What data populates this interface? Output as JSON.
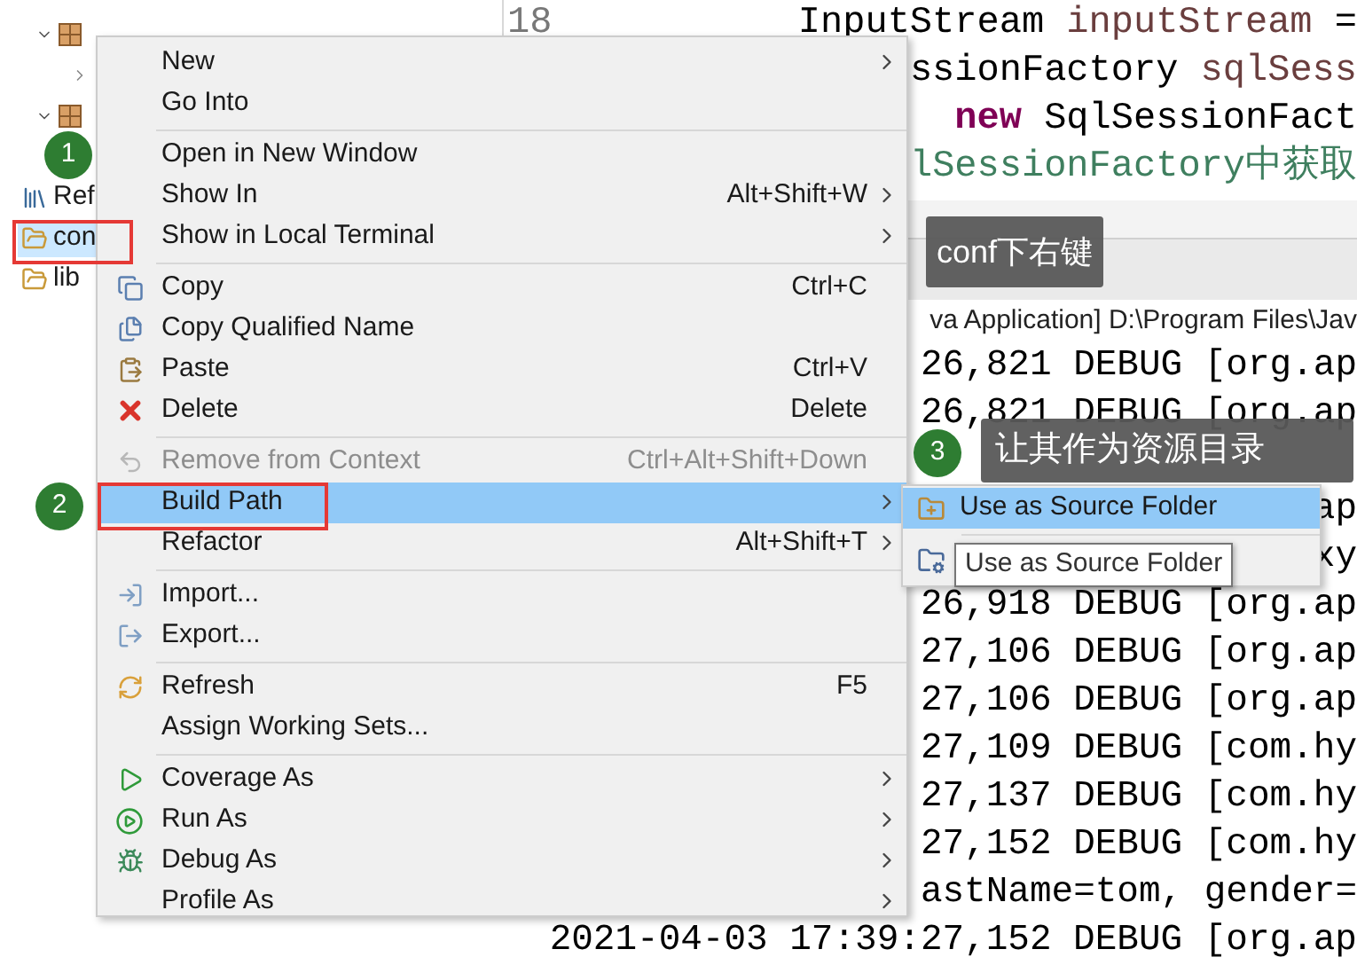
{
  "tree": [
    {
      "children": [
        {
          "kind": "package",
          "expanded": true,
          "children": [
            {
              "expanded": false
            }
          ]
        },
        {
          "kind": "package",
          "expanded": true
        }
      ]
    },
    {
      "label": "Ref",
      "kind": "library",
      "selected": false
    },
    {
      "label": "con",
      "kind": "folder",
      "selected": true
    },
    {
      "label": "lib",
      "kind": "folder",
      "selected": false
    }
  ],
  "editor": {
    "line_number": "18",
    "lines": [
      [
        {
          "kind": "plain",
          "text": "InputStream "
        },
        {
          "kind": "variable",
          "text": "inputStream"
        },
        {
          "kind": "plain",
          "text": " ="
        }
      ],
      [
        {
          "kind": "plain",
          "text": "ssionFactory "
        },
        {
          "kind": "variable",
          "text": "sqlSess"
        }
      ],
      [
        {
          "kind": "keyword",
          "text": "new"
        },
        {
          "kind": "plain",
          "text": " SqlSessionFact"
        }
      ],
      [
        {
          "kind": "comment",
          "text": "lSessionFactory中获取"
        }
      ]
    ]
  },
  "console": {
    "header": "va Application] D:\\Program Files\\Jav",
    "lines": [
      {
        "text": "26,821 DEBUG [org.ap"
      },
      {
        "text": "26,821 DEBUG [org.ap"
      },
      {
        "text": "ap"
      },
      {
        "text": "xy"
      },
      {
        "text": "26,918 DEBUG [org.ap"
      },
      {
        "text": "27,106 DEBUG [org.ap"
      },
      {
        "text": "27,106 DEBUG [org.ap"
      },
      {
        "text": "27,109 DEBUG [com.hy"
      },
      {
        "text": "27,137 DEBUG [com.hy"
      },
      {
        "text": "27,152 DEBUG [com.hy"
      },
      {
        "text": "astName=tom, gender="
      },
      {
        "text": "2021-04-03 17:39:27,152 DEBUG [org.ap"
      }
    ]
  },
  "context_menu": [
    {
      "kind": "item",
      "label": "New",
      "submenu": true,
      "disabled": false,
      "selected": false
    },
    {
      "kind": "item",
      "label": "Go Into",
      "submenu": false,
      "disabled": false,
      "selected": false
    },
    {
      "kind": "separator"
    },
    {
      "kind": "item",
      "label": "Open in New Window",
      "submenu": false,
      "disabled": false,
      "selected": false
    },
    {
      "kind": "item",
      "label": "Show In",
      "shortcut": "Alt+Shift+W",
      "submenu": true,
      "disabled": false,
      "selected": false
    },
    {
      "kind": "item",
      "label": "Show in Local Terminal",
      "submenu": true,
      "disabled": false,
      "selected": false
    },
    {
      "kind": "separator"
    },
    {
      "kind": "item",
      "label": "Copy",
      "shortcut": "Ctrl+C",
      "submenu": false,
      "disabled": false,
      "selected": false
    },
    {
      "kind": "item",
      "label": "Copy Qualified Name",
      "submenu": false,
      "disabled": false,
      "selected": false
    },
    {
      "kind": "item",
      "label": "Paste",
      "shortcut": "Ctrl+V",
      "submenu": false,
      "disabled": false,
      "selected": false
    },
    {
      "kind": "item",
      "label": "Delete",
      "shortcut": "Delete",
      "submenu": false,
      "disabled": false,
      "selected": false
    },
    {
      "kind": "separator"
    },
    {
      "kind": "item",
      "label": "Remove from Context",
      "shortcut": "Ctrl+Alt+Shift+Down",
      "submenu": false,
      "disabled": true,
      "selected": false
    },
    {
      "kind": "item",
      "label": "Build Path",
      "submenu": true,
      "disabled": false,
      "selected": true
    },
    {
      "kind": "item",
      "label": "Refactor",
      "shortcut": "Alt+Shift+T",
      "submenu": true,
      "disabled": false,
      "selected": false
    },
    {
      "kind": "separator"
    },
    {
      "kind": "item",
      "label": "Import...",
      "submenu": false,
      "disabled": false,
      "selected": false
    },
    {
      "kind": "item",
      "label": "Export...",
      "submenu": false,
      "disabled": false,
      "selected": false
    },
    {
      "kind": "separator"
    },
    {
      "kind": "item",
      "label": "Refresh",
      "shortcut": "F5",
      "submenu": false,
      "disabled": false,
      "selected": false
    },
    {
      "kind": "item",
      "label": "Assign Working Sets...",
      "submenu": false,
      "disabled": false,
      "selected": false
    },
    {
      "kind": "separator"
    },
    {
      "kind": "item",
      "label": "Coverage As",
      "submenu": true,
      "disabled": false,
      "selected": false
    },
    {
      "kind": "item",
      "label": "Run As",
      "submenu": true,
      "disabled": false,
      "selected": false
    },
    {
      "kind": "item",
      "label": "Debug As",
      "submenu": true,
      "disabled": false,
      "selected": false
    },
    {
      "kind": "item",
      "label": "Profile As",
      "submenu": true,
      "disabled": false,
      "selected": false
    }
  ],
  "submenu": [
    {
      "label": "Use as Source Folder",
      "selected": true
    },
    {
      "selected": false
    }
  ],
  "tooltip": {
    "text": "Use as Source Folder"
  },
  "callouts": [
    {
      "number": "1",
      "text": "conf下右键"
    },
    {
      "number": "2"
    },
    {
      "number": "3",
      "text": "让其作为资源目录"
    }
  ]
}
